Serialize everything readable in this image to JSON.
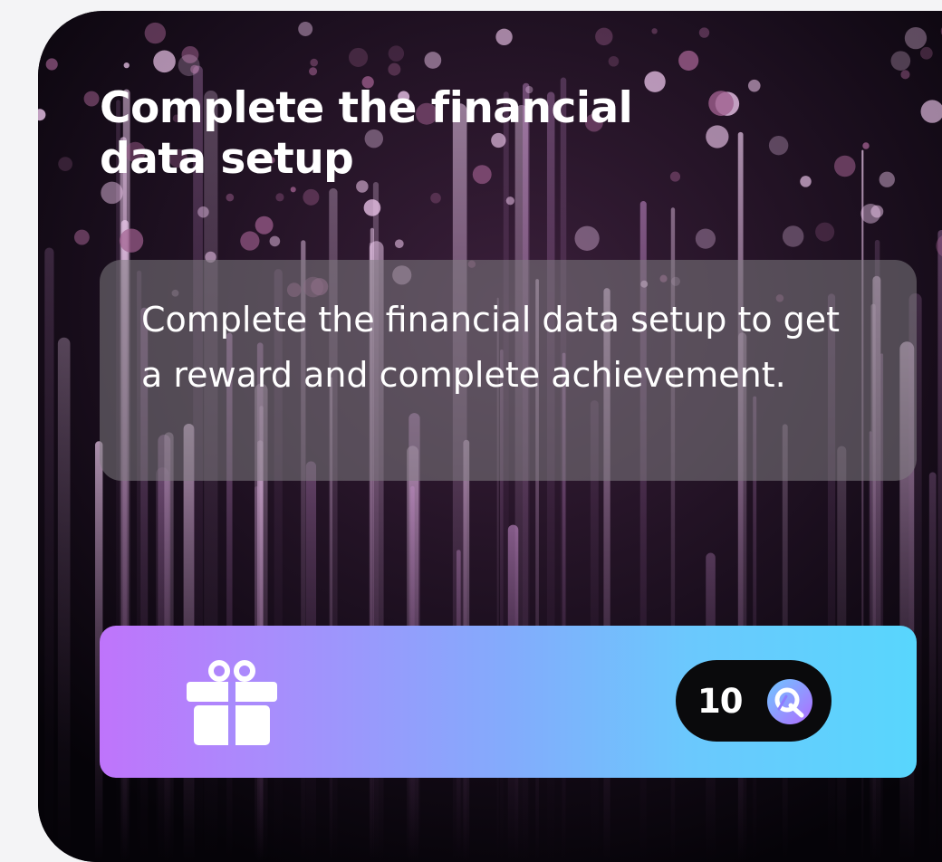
{
  "card": {
    "title": "Complete the financial data setup",
    "description": "Complete the financial data setup to get a reward and complete achievement."
  },
  "reward": {
    "icon": "gift-icon",
    "amount": "10",
    "currency_icon": "coin-logo-icon"
  },
  "colors": {
    "gradient_start": "#bf74fb",
    "gradient_end": "#58d6fd",
    "badge_bg": "#0a0a0c",
    "card_bg": "#08050b"
  }
}
